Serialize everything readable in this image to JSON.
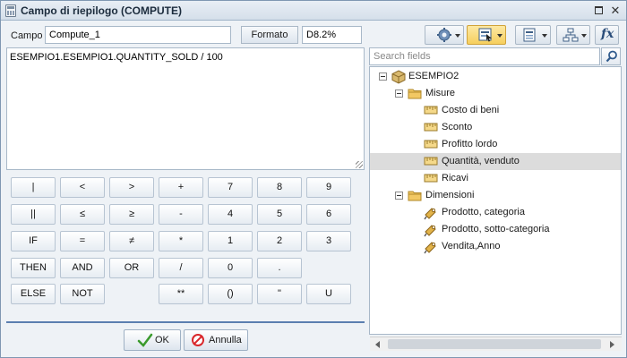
{
  "window": {
    "title": "Campo di riepilogo (COMPUTE)"
  },
  "field": {
    "label": "Campo",
    "value": "Compute_1",
    "format_button": "Formato",
    "format_value": "D8.2%"
  },
  "expression": {
    "text": "ESEMPIO1.ESEMPIO1.QUANTITY_SOLD / 100"
  },
  "keypad": [
    [
      "|",
      "<",
      ">",
      "+",
      "7",
      "8",
      "9"
    ],
    [
      "||",
      "≤",
      "≥",
      "-",
      "4",
      "5",
      "6"
    ],
    [
      "IF",
      "=",
      "≠",
      "*",
      "1",
      "2",
      "3"
    ],
    [
      "THEN",
      "AND",
      "OR",
      "/",
      "0",
      "."
    ],
    [
      "ELSE",
      "NOT",
      "",
      "**",
      "()",
      "\"",
      "U"
    ]
  ],
  "actions": {
    "ok": "OK",
    "cancel": "Annulla"
  },
  "search": {
    "placeholder": "Search fields"
  },
  "tree": {
    "root": "ESEMPIO2",
    "measures_folder": "Misure",
    "measures": [
      "Costo di beni",
      "Sconto",
      "Profitto lordo",
      "Quantità, venduto",
      "Ricavi"
    ],
    "dimensions_folder": "Dimensioni",
    "dimensions": [
      "Prodotto, categoria",
      "Prodotto, sotto-categoria",
      "Vendita,Anno"
    ],
    "selected": "Quantità, venduto"
  },
  "toolbar": {
    "icons": [
      "gear-icon",
      "field-select-icon",
      "layout-icon",
      "hierarchy-icon",
      "function-icon"
    ],
    "function_glyph": "fx"
  },
  "colors": {
    "accent": "#5b7fb0",
    "selected_row": "#dcdcdc",
    "active_toolbar": "#f6cf5e"
  }
}
